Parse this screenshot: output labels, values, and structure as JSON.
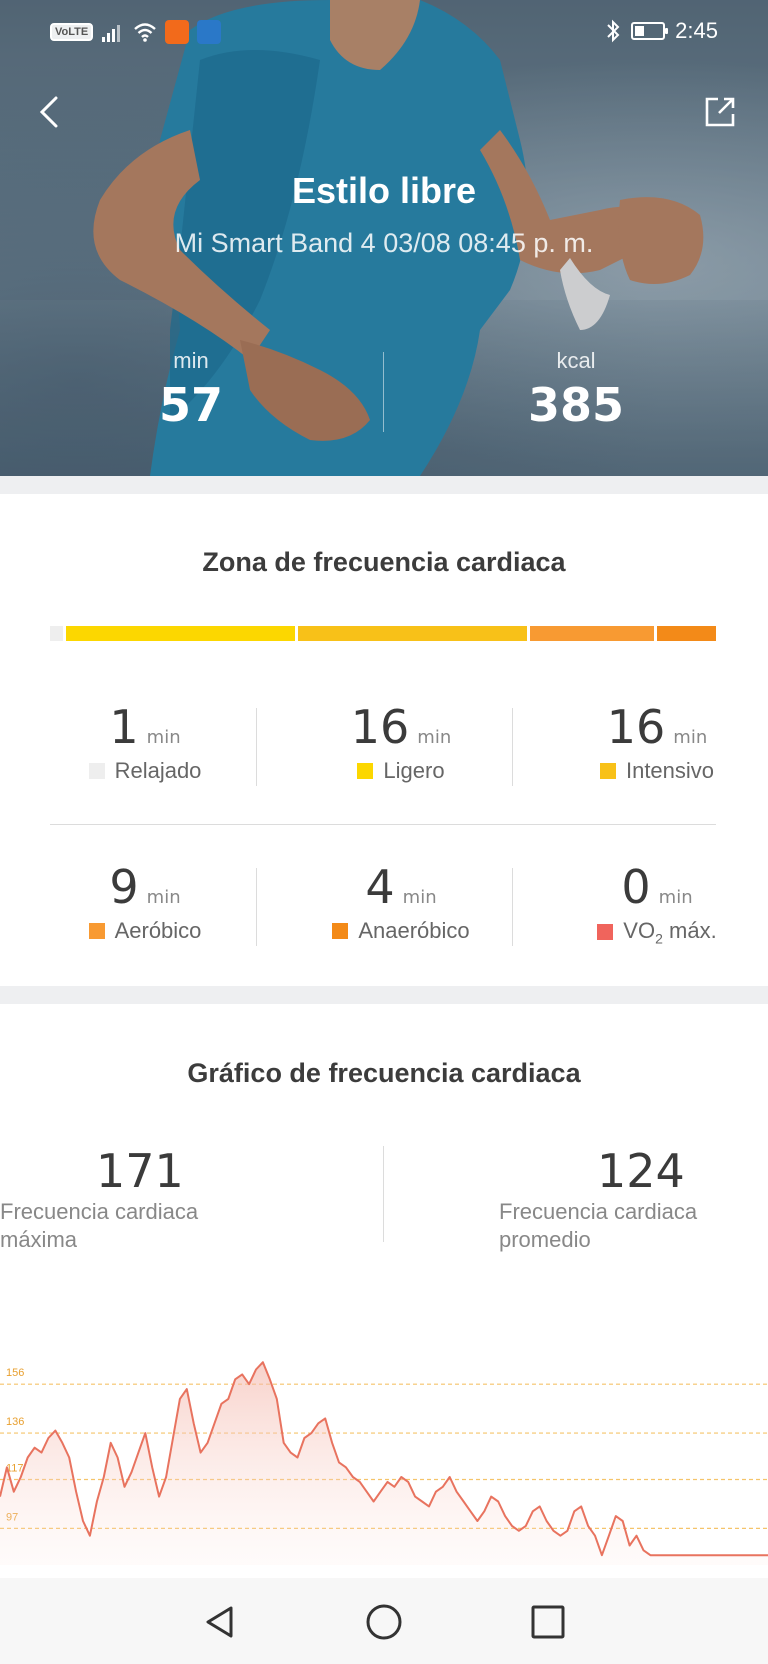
{
  "status_bar": {
    "network_badge": "VoLTE",
    "time": "2:45",
    "battery_level": 0.35,
    "icons": [
      "signal-icon",
      "wifi-icon",
      "app-notification-icon",
      "shield-app-icon",
      "bluetooth-icon",
      "battery-icon"
    ]
  },
  "header": {
    "title": "Estilo libre",
    "subtitle": "Mi Smart Band 4 03/08 08:45 p. m.",
    "duration_unit": "min",
    "duration_value": "57",
    "calories_unit": "kcal",
    "calories_value": "385"
  },
  "zones": {
    "title": "Zona de frecuencia cardiaca",
    "unit": "min",
    "bar_fractions": [
      0.02,
      0.35,
      0.35,
      0.19,
      0.09
    ],
    "items": [
      {
        "value": "1",
        "label": "Relajado",
        "color": "#eeeeee"
      },
      {
        "value": "16",
        "label": "Ligero",
        "color": "#fcd700"
      },
      {
        "value": "16",
        "label": "Intensivo",
        "color": "#f8c118"
      },
      {
        "value": "9",
        "label": "Aeróbico",
        "color": "#f89a32"
      },
      {
        "value": "4",
        "label": "Anaeróbico",
        "color": "#f38a18"
      },
      {
        "value": "0",
        "label_main": "VO",
        "label_sub": "2",
        "label_rest": " máx.",
        "color": "#f0645c"
      }
    ]
  },
  "heart_rate": {
    "title": "Gráfico de frecuencia cardiaca",
    "max_value": "171",
    "max_label": "Frecuencia cardiaca máxima",
    "avg_value": "124",
    "avg_label": "Frecuencia cardiaca promedio"
  },
  "chart_data": {
    "type": "area",
    "y_ticks": [
      "156",
      "136",
      "117",
      "97"
    ],
    "y_tick_values": [
      156,
      136,
      117,
      97
    ],
    "line_color": "#e8735f",
    "values": [
      110,
      122,
      112,
      118,
      126,
      130,
      128,
      134,
      137,
      132,
      126,
      112,
      100,
      94,
      108,
      118,
      132,
      126,
      114,
      120,
      128,
      136,
      122,
      110,
      118,
      134,
      150,
      154,
      140,
      128,
      132,
      140,
      148,
      150,
      158,
      160,
      156,
      162,
      165,
      158,
      150,
      132,
      128,
      126,
      134,
      136,
      140,
      142,
      132,
      124,
      122,
      118,
      116,
      112,
      108,
      112,
      116,
      114,
      118,
      116,
      110,
      108,
      106,
      112,
      114,
      118,
      112,
      108,
      104,
      100,
      104,
      110,
      108,
      102,
      98,
      96,
      98,
      104,
      106,
      100,
      96,
      94,
      96,
      104,
      106,
      98,
      94,
      86,
      94,
      102,
      100,
      90,
      94,
      88,
      86,
      86,
      86,
      86,
      86,
      86,
      86,
      86,
      86,
      86,
      86,
      86,
      86,
      86,
      86,
      86,
      86,
      86
    ]
  },
  "nav_bar": {
    "back": "back-triangle-icon",
    "home": "home-circle-icon",
    "recents": "recents-square-icon"
  }
}
